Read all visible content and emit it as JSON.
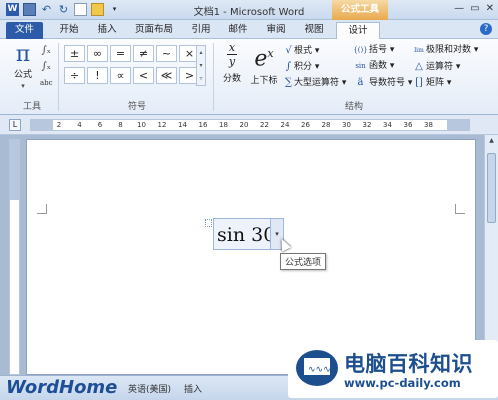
{
  "app": {
    "window_title": "文档1 - Microsoft Word",
    "context_tab_group": "公式工具"
  },
  "tabs": [
    {
      "label": "文件"
    },
    {
      "label": "开始"
    },
    {
      "label": "插入"
    },
    {
      "label": "页面布局"
    },
    {
      "label": "引用"
    },
    {
      "label": "邮件"
    },
    {
      "label": "审阅"
    },
    {
      "label": "视图"
    },
    {
      "label": "设计"
    }
  ],
  "ribbon": {
    "tools_group": {
      "formula_label": "公式",
      "formula_glyph": "π",
      "label": "工具"
    },
    "symbols_group": {
      "symbols": [
        "±",
        "∞",
        "=",
        "≠",
        "~",
        "×",
        "÷",
        "!",
        "∝",
        "<",
        "≪",
        ">"
      ],
      "label": "符号"
    },
    "structures_group": {
      "fraction_label": "分数",
      "script_label": "上下标",
      "list1": [
        {
          "glyph": "√",
          "label": "根式 ▾"
        },
        {
          "glyph": "∫",
          "label": "积分 ▾"
        },
        {
          "glyph": "∑",
          "label": "大型运算符 ▾"
        }
      ],
      "list2": [
        {
          "glyph": "{()}",
          "label": "括号 ▾"
        },
        {
          "glyph": "sin",
          "label": "函数 ▾"
        },
        {
          "glyph": "ä",
          "label": "导数符号 ▾"
        }
      ],
      "list3": [
        {
          "glyph": "lim",
          "label": "极限和对数 ▾"
        },
        {
          "glyph": "△",
          "label": "运算符 ▾"
        },
        {
          "glyph": "[]",
          "label": "矩阵 ▾"
        }
      ],
      "label": "结构"
    }
  },
  "ruler": {
    "ticks": [
      "2",
      "4",
      "6",
      "8",
      "10",
      "12",
      "14",
      "16",
      "18",
      "20",
      "22",
      "24",
      "26",
      "28",
      "30",
      "32",
      "34",
      "36",
      "38"
    ]
  },
  "document": {
    "equation": "sin 30",
    "tooltip": "公式选项"
  },
  "statusbar": {
    "language": "英语(美国)",
    "mode": "插入",
    "brand": "WordHome"
  },
  "watermark": {
    "title": "电脑百科知识",
    "url": "www.pc-daily.com"
  },
  "colors": {
    "accent": "#2b5ba9",
    "context_tab": "#e8a94d",
    "brand": "#1d4f8f"
  }
}
